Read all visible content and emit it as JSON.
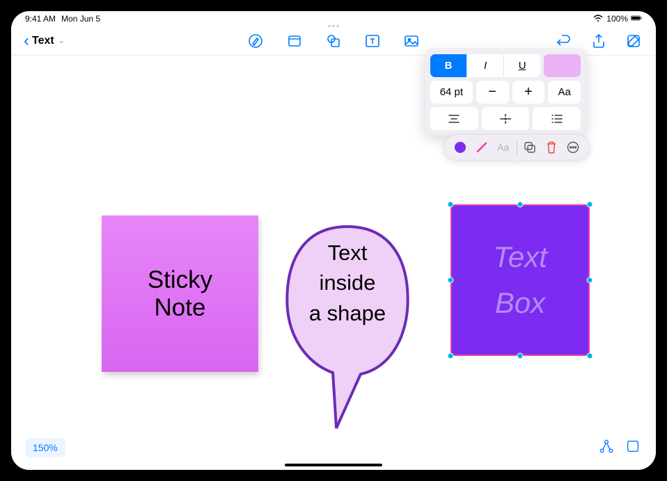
{
  "status_bar": {
    "time": "9:41 AM",
    "date": "Mon Jun 5",
    "battery": "100%"
  },
  "toolbar": {
    "title": "Text"
  },
  "canvas": {
    "sticky_note": {
      "line1": "Sticky",
      "line2": "Note"
    },
    "speech_bubble": {
      "line1": "Text",
      "line2": "inside",
      "line3": "a shape"
    },
    "text_box": {
      "line1": "Text",
      "line2": "Box"
    }
  },
  "format_popover": {
    "bold": "B",
    "italic": "I",
    "underline": "U",
    "font_size": "64 pt",
    "minus": "−",
    "plus": "+",
    "text_style": "Aa"
  },
  "context_toolbar": {
    "text_edit_label": "Aa"
  },
  "zoom": "150%",
  "colors": {
    "accent": "#007aff",
    "sticky": "#e786f9",
    "bubble_fill": "#efd0f7",
    "bubble_stroke": "#6d2bb5",
    "textbox_fill": "#7b2cf0",
    "textbox_border": "#e63fa8",
    "swatch": "#e9b3f5",
    "fill_dot": "#7b2cf0",
    "stroke_tool": "#e63fa8",
    "trash": "#e74c3c"
  }
}
